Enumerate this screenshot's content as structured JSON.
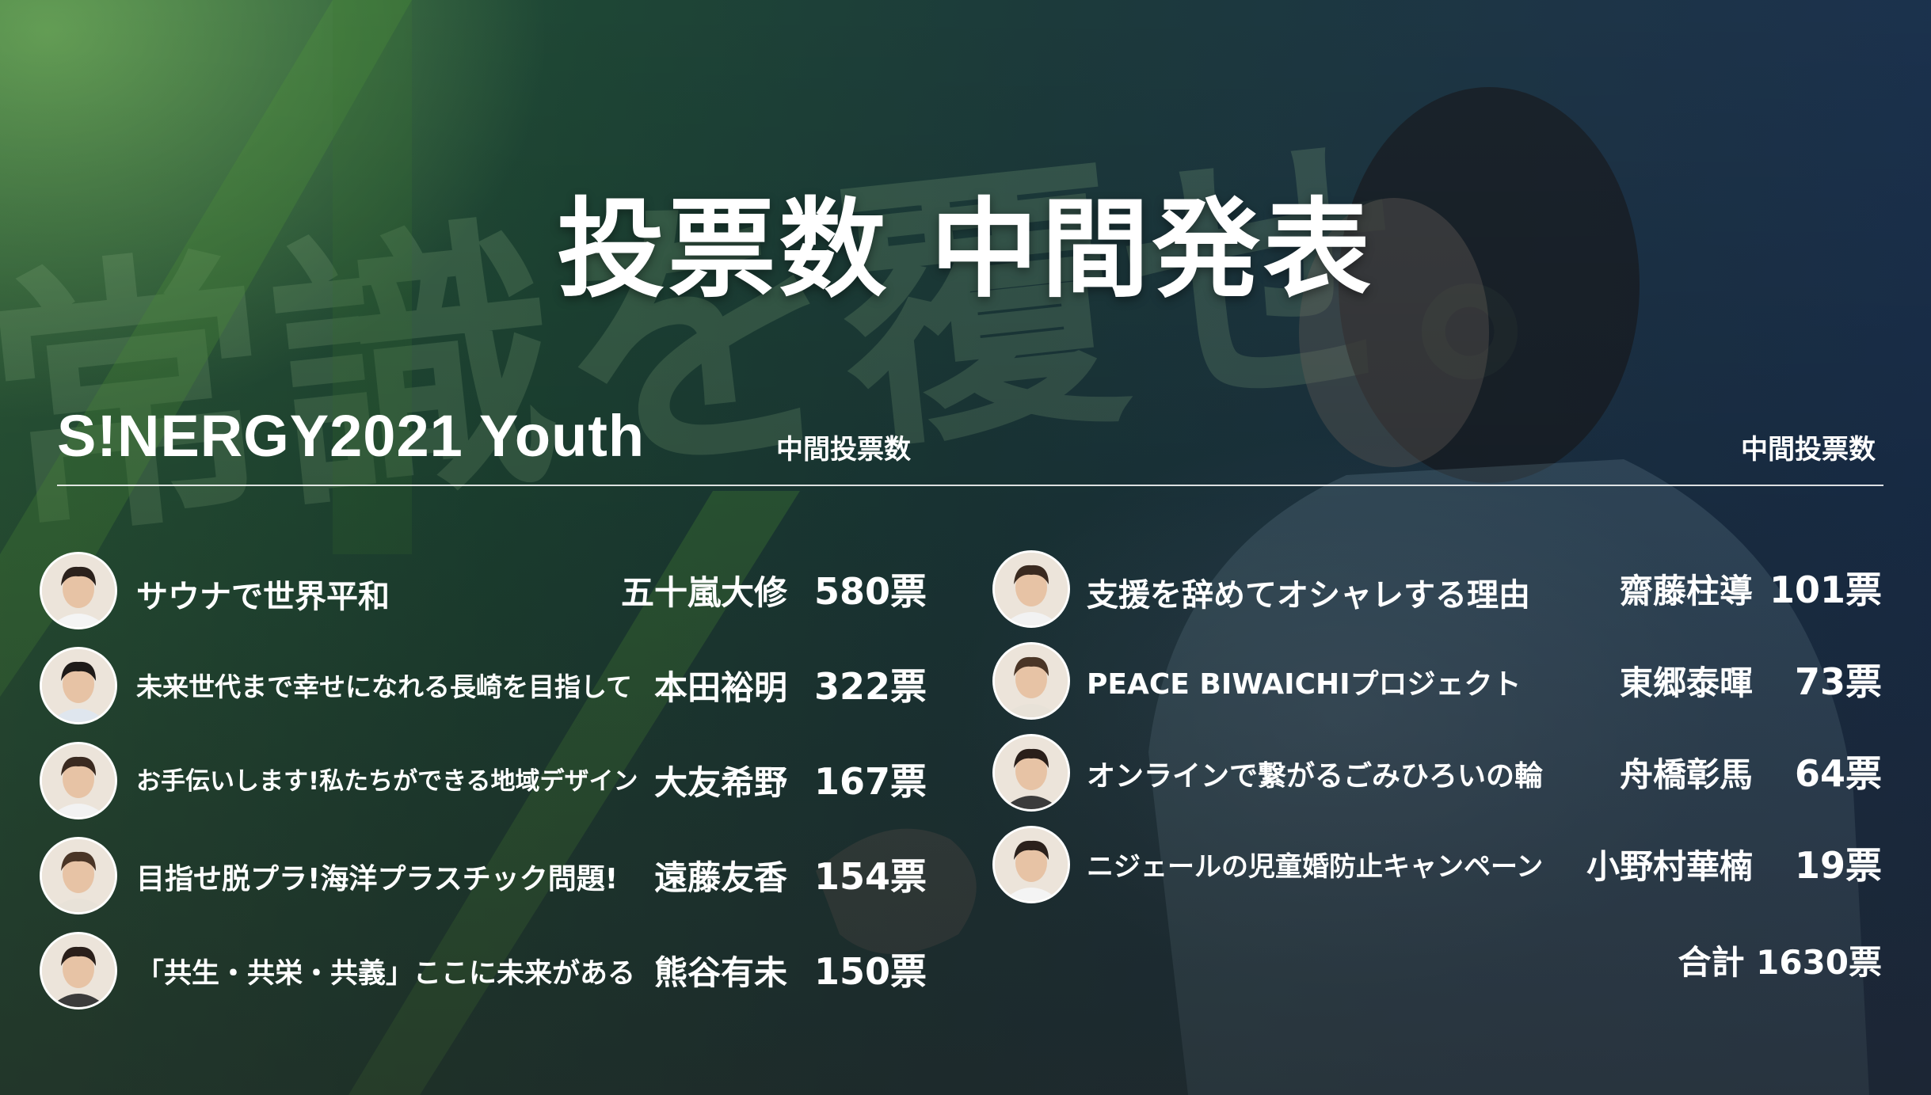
{
  "title": "投票数 中間発表",
  "event": "S!NERGY2021  Youth",
  "column_header_left": "中間投票数",
  "column_header_right": "中間投票数",
  "watermark_text": "常識を覆せ。",
  "left_entries": [
    {
      "project": "サウナで世界平和",
      "person": "五十嵐大修",
      "votes": "580票"
    },
    {
      "project": "未来世代まで幸せになれる長崎を目指して",
      "person": "本田裕明",
      "votes": "322票"
    },
    {
      "project": "お手伝いします!私たちができる地域デザイン",
      "person": "大友希野",
      "votes": "167票"
    },
    {
      "project": "目指せ脱プラ!海洋プラスチック問題!",
      "person": "遠藤友香",
      "votes": "154票"
    },
    {
      "project": "「共生・共栄・共義」ここに未来がある",
      "person": "熊谷有未",
      "votes": "150票"
    }
  ],
  "right_entries": [
    {
      "project": "支援を辞めてオシャレする理由",
      "person": "齋藤柱導",
      "votes": "101票"
    },
    {
      "project": "PEACE BIWAICHIプロジェクト",
      "person": "東郷泰暉",
      "votes": "73票"
    },
    {
      "project": "オンラインで繋がるごみひろいの輪",
      "person": "舟橋彰馬",
      "votes": "64票"
    },
    {
      "project": "ニジェールの児童婚防止キャンペーン",
      "person": "小野村華楠",
      "votes": "19票"
    }
  ],
  "total": "合計  1630票",
  "colors": {
    "accent_green": "#3f8f3a",
    "text": "#ffffff"
  }
}
